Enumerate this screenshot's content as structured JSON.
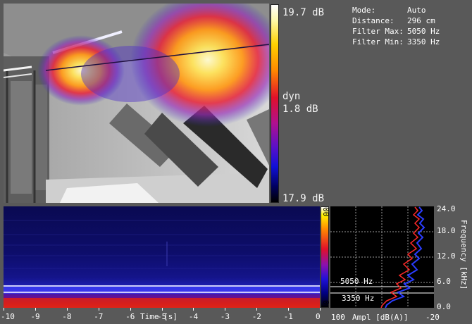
{
  "colorbar": {
    "max_label": "19.7 dB",
    "mode_label": "dyn",
    "mid_label": "1.8 dB",
    "min_label": "17.9 dB"
  },
  "info": {
    "mode_key": "Mode:",
    "mode_value": "Auto",
    "distance_key": "Distance:",
    "distance_value": "296 cm",
    "fmax_key": "Filter Max:",
    "fmax_value": "5050 Hz",
    "fmin_key": "Filter Min:",
    "fmin_value": "3350 Hz"
  },
  "spectrogram": {
    "mini_colorbar": {
      "top_label": "00",
      "bottom_label": "0"
    },
    "x_ticks": [
      "-10",
      "-9",
      "-8",
      "-7",
      "-6",
      "-5",
      "-4",
      "-3",
      "-2",
      "-1",
      "0"
    ],
    "x_title": "Time [s]"
  },
  "amplitude": {
    "filter_max_label": "5050 Hz",
    "filter_min_label": "3350 Hz",
    "x_ticks": [
      "100",
      "-20"
    ],
    "x_title": "Ampl [dB(A)]",
    "y_ticks": [
      "24.0",
      "18.0",
      "12.0",
      "6.0",
      "0.0"
    ],
    "y_title": "Frequency [kHz]"
  },
  "colors": {
    "background": "#595959",
    "highlight_line": "#ffffff",
    "trace_red": "#ff2a2a",
    "trace_blue": "#2a3dff"
  }
}
